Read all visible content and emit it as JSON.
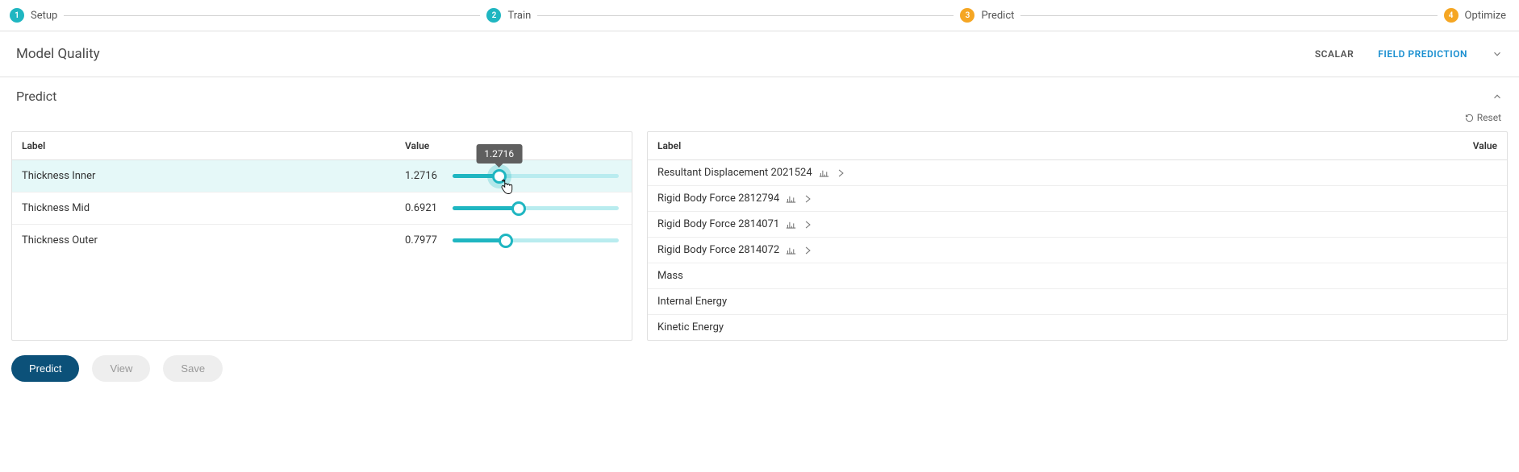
{
  "stepper": {
    "steps": [
      {
        "num": "1",
        "label": "Setup",
        "color": "teal"
      },
      {
        "num": "2",
        "label": "Train",
        "color": "teal"
      },
      {
        "num": "3",
        "label": "Predict",
        "color": "amber"
      },
      {
        "num": "4",
        "label": "Optimize",
        "color": "amber"
      }
    ]
  },
  "model_quality": {
    "title": "Model Quality",
    "tabs": {
      "scalar": "SCALAR",
      "field": "FIELD PREDICTION"
    }
  },
  "predict": {
    "title": "Predict",
    "reset_label": "Reset",
    "headers": {
      "label": "Label",
      "value": "Value"
    },
    "tooltip_value": "1.2716",
    "inputs": [
      {
        "label": "Thickness Inner",
        "value": "1.2716",
        "pct": 28,
        "highlight": true,
        "glow": true,
        "show_tooltip": true,
        "show_cursor": true
      },
      {
        "label": "Thickness Mid",
        "value": "0.6921",
        "pct": 40,
        "highlight": false,
        "glow": false,
        "show_tooltip": false,
        "show_cursor": false
      },
      {
        "label": "Thickness Outer",
        "value": "0.7977",
        "pct": 32,
        "highlight": false,
        "glow": false,
        "show_tooltip": false,
        "show_cursor": false
      }
    ],
    "outputs": [
      {
        "label": "Resultant Displacement 2021524",
        "has_chart_icon": true,
        "has_chevron": true
      },
      {
        "label": "Rigid Body Force 2812794",
        "has_chart_icon": true,
        "has_chevron": true
      },
      {
        "label": "Rigid Body Force 2814071",
        "has_chart_icon": true,
        "has_chevron": true
      },
      {
        "label": "Rigid Body Force 2814072",
        "has_chart_icon": true,
        "has_chevron": true
      },
      {
        "label": "Mass",
        "has_chart_icon": false,
        "has_chevron": false
      },
      {
        "label": "Internal Energy",
        "has_chart_icon": false,
        "has_chevron": false
      },
      {
        "label": "Kinetic Energy",
        "has_chart_icon": false,
        "has_chevron": false
      }
    ]
  },
  "buttons": {
    "predict": "Predict",
    "view": "View",
    "save": "Save"
  }
}
